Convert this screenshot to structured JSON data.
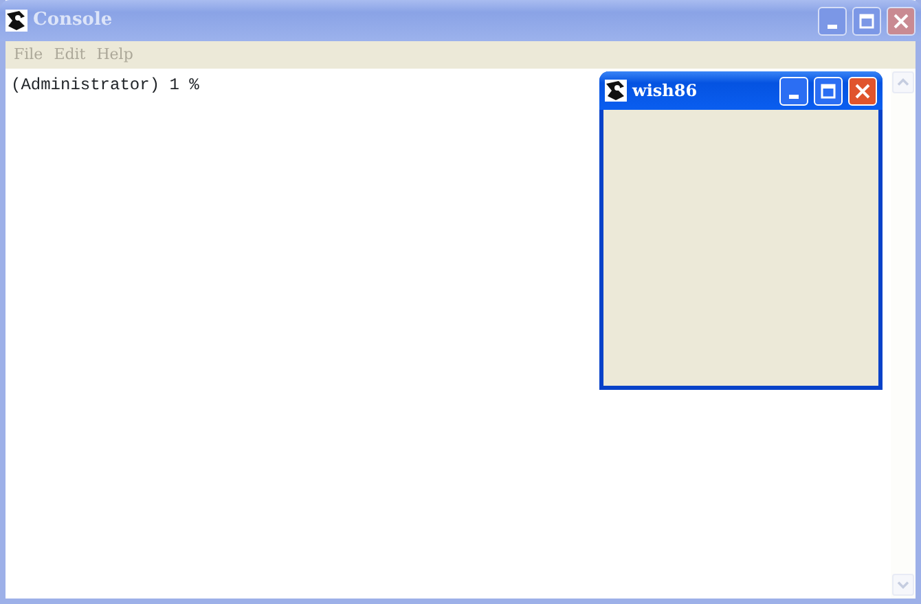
{
  "console": {
    "title": "Console",
    "active": false,
    "menu": [
      {
        "label": "File",
        "disabled": true
      },
      {
        "label": "Edit",
        "disabled": true
      },
      {
        "label": "Help",
        "disabled": true
      }
    ],
    "output": "(Administrator) 1 %"
  },
  "wish": {
    "title": "wish86",
    "active": true
  }
}
